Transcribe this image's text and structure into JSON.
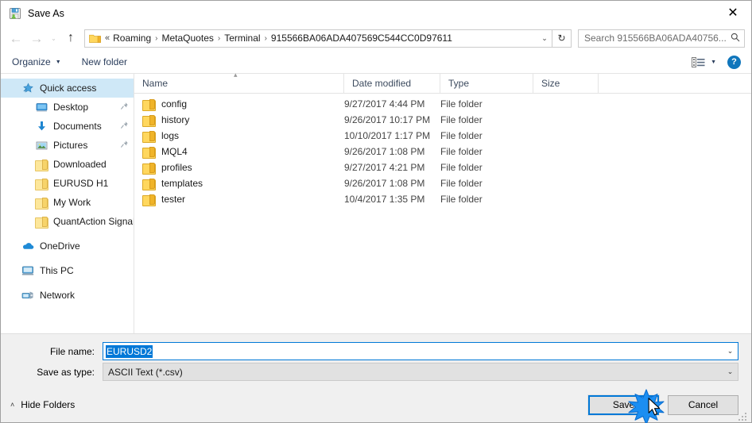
{
  "window": {
    "title": "Save As",
    "title_icon": "save-as-icon",
    "close_label": "✕"
  },
  "nav": {
    "back_icon": "back-arrow-icon",
    "back_glyph": "←",
    "forward_icon": "forward-arrow-icon",
    "forward_glyph": "→",
    "recent_icon": "recent-locations-icon",
    "recent_glyph": "⌄",
    "up_icon": "up-arrow-icon",
    "up_glyph": "↑",
    "refresh_icon": "refresh-icon",
    "refresh_glyph": "↻",
    "address_dropdown_glyph": "⌄",
    "breadcrumb_prefix": "«",
    "breadcrumb_separator": "›",
    "breadcrumbs": [
      "Roaming",
      "MetaQuotes",
      "Terminal",
      "915566BA06ADA407569C544CC0D97611"
    ]
  },
  "search": {
    "placeholder": "Search 915566BA06ADA40756...",
    "icon": "search-icon",
    "icon_glyph": "⌕"
  },
  "toolbar": {
    "organize_label": "Organize",
    "organize_caret": "▼",
    "new_folder_label": "New folder",
    "view_icon": "view-layout-icon",
    "view_caret": "▼",
    "help_icon": "help-icon",
    "help_glyph": "?"
  },
  "sidebar": {
    "groups": [
      {
        "items": [
          {
            "label": "Quick access",
            "icon": "quick-access-star-icon",
            "level": 0,
            "selected": true,
            "pinned": false
          },
          {
            "label": "Desktop",
            "icon": "desktop-monitor-icon",
            "level": 1,
            "selected": false,
            "pinned": true
          },
          {
            "label": "Documents",
            "icon": "documents-download-icon",
            "level": 1,
            "selected": false,
            "pinned": true
          },
          {
            "label": "Pictures",
            "icon": "pictures-icon",
            "level": 1,
            "selected": false,
            "pinned": true
          },
          {
            "label": "Downloaded",
            "icon": "folder-icon",
            "level": 1,
            "selected": false,
            "pinned": false
          },
          {
            "label": "EURUSD H1",
            "icon": "folder-icon",
            "level": 1,
            "selected": false,
            "pinned": false
          },
          {
            "label": "My Work",
            "icon": "folder-icon",
            "level": 1,
            "selected": false,
            "pinned": false
          },
          {
            "label": "QuantAction Signal",
            "icon": "folder-icon",
            "level": 1,
            "selected": false,
            "pinned": false
          }
        ]
      },
      {
        "items": [
          {
            "label": "OneDrive",
            "icon": "onedrive-cloud-icon",
            "level": 0,
            "selected": false,
            "pinned": false
          }
        ]
      },
      {
        "items": [
          {
            "label": "This PC",
            "icon": "this-pc-icon",
            "level": 0,
            "selected": false,
            "pinned": false
          }
        ]
      },
      {
        "items": [
          {
            "label": "Network",
            "icon": "network-icon",
            "level": 0,
            "selected": false,
            "pinned": false
          }
        ]
      }
    ],
    "pin_glyph": "📌"
  },
  "filelist": {
    "columns": [
      {
        "key": "name",
        "label": "Name"
      },
      {
        "key": "date",
        "label": "Date modified"
      },
      {
        "key": "type",
        "label": "Type"
      },
      {
        "key": "size",
        "label": "Size"
      }
    ],
    "sort_column": "Name",
    "sort_direction": "ascending",
    "sort_glyph": "▴",
    "rows": [
      {
        "name": "config",
        "date": "9/27/2017 4:44 PM",
        "type": "File folder",
        "size": "",
        "icon": "folder-icon"
      },
      {
        "name": "history",
        "date": "9/26/2017 10:17 PM",
        "type": "File folder",
        "size": "",
        "icon": "folder-icon"
      },
      {
        "name": "logs",
        "date": "10/10/2017 1:17 PM",
        "type": "File folder",
        "size": "",
        "icon": "folder-icon"
      },
      {
        "name": "MQL4",
        "date": "9/26/2017 1:08 PM",
        "type": "File folder",
        "size": "",
        "icon": "folder-icon"
      },
      {
        "name": "profiles",
        "date": "9/27/2017 4:21 PM",
        "type": "File folder",
        "size": "",
        "icon": "folder-icon"
      },
      {
        "name": "templates",
        "date": "9/26/2017 1:08 PM",
        "type": "File folder",
        "size": "",
        "icon": "folder-icon"
      },
      {
        "name": "tester",
        "date": "10/4/2017 1:35 PM",
        "type": "File folder",
        "size": "",
        "icon": "folder-icon"
      }
    ]
  },
  "form": {
    "filename_label": "File name:",
    "filename_value": "EURUSD2",
    "filename_selected": true,
    "filetype_label": "Save as type:",
    "filetype_value": "ASCII Text (*.csv)",
    "dropdown_glyph": "⌄"
  },
  "footer": {
    "hide_folders_label": "Hide Folders",
    "hide_folders_caret": "˄",
    "save_label": "Save",
    "cancel_label": "Cancel",
    "resize_grip_icon": "resize-grip-icon"
  },
  "pointer": {
    "cursor_icon": "mouse-cursor-icon",
    "click_effect_icon": "click-burst-icon",
    "accent_color": "#0078d7"
  }
}
